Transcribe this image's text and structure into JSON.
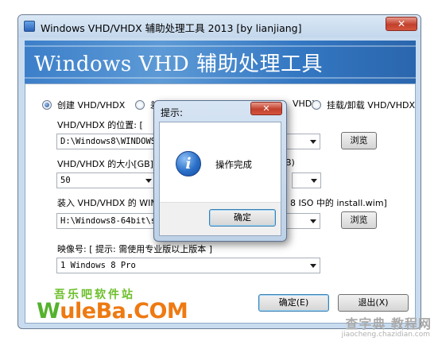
{
  "window": {
    "title": "Windows VHD/VHDX 辅助处理工具 2013 [by lianjiang]",
    "close_glyph": "✕"
  },
  "banner": {
    "title": "Windows VHD 辅助处理工具"
  },
  "options": {
    "create_label": "创建 VHD/VHDX",
    "diff_label_visible": "差",
    "diff_label_tail": "VHDX",
    "mount_label": "挂载/卸载 VHD/VHDX",
    "selected": "create"
  },
  "location": {
    "label": "VHD/VHDX  的位置:  [",
    "value": "D:\\Windows8\\WINDOWS8",
    "browse_label": "浏览"
  },
  "size": {
    "label": "VHD/VHDX 的大小[GB]",
    "label_tail": "B)",
    "value": "50"
  },
  "wim": {
    "label": "装入 VHD/VHDX  的 WIM",
    "label_tail": "8 ISO 中的 install.wim]",
    "value": "H:\\Windows8-64bit\\so",
    "browse_label": "浏览"
  },
  "image_index": {
    "label": "映像号: [ 提示: 需使用专业版以上版本 ]",
    "value": "1   Windows 8 Pro"
  },
  "footer": {
    "ok_label": "确定(E)",
    "exit_label": "退出(X)"
  },
  "logo": {
    "cn_text": "吾乐吧软件站",
    "en_prefix": "W",
    "en_rest": "uleBa.COM"
  },
  "dialog": {
    "title": "提示:",
    "close_glyph": "✕",
    "info_glyph": "i",
    "message": "操作完成",
    "ok_label": "确定"
  },
  "watermark": {
    "main": "查字典 教程网",
    "sub": "jiaocheng.chazidian.com"
  },
  "colors": {
    "banner_blue": "#3c7fc9",
    "logo_orange": "#ee7a12",
    "logo_green": "#6cbf2a"
  }
}
